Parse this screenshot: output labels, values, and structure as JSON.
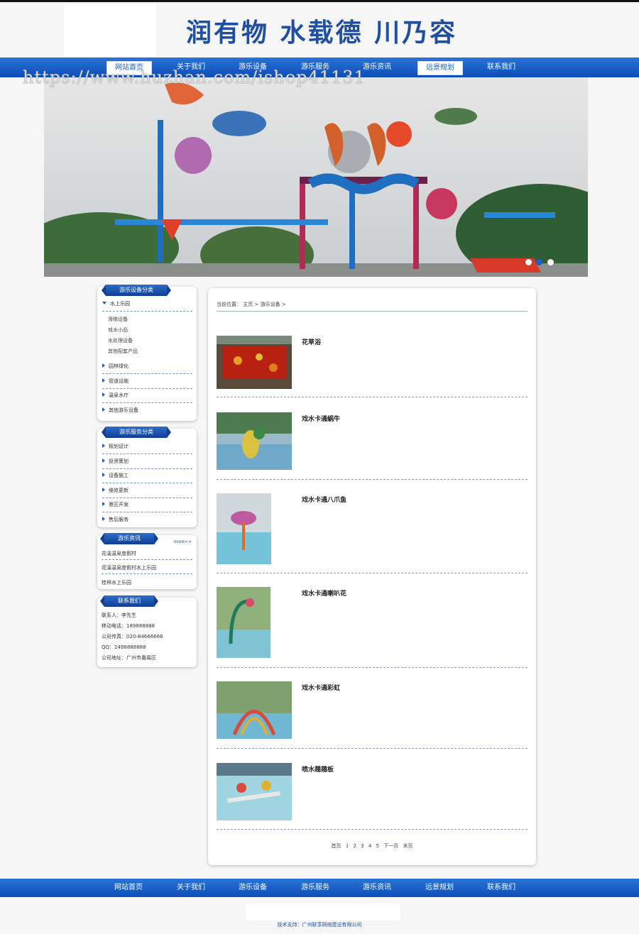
{
  "header": {
    "slogan": "润有物 水载德 川乃容"
  },
  "watermark": "https://www.huzhan.com/ishop41131",
  "nav": [
    {
      "label": "网站首页",
      "active": true
    },
    {
      "label": "关于我们",
      "active": false
    },
    {
      "label": "游乐设备",
      "active": false
    },
    {
      "label": "游乐服务",
      "active": false
    },
    {
      "label": "游乐资讯",
      "active": false
    },
    {
      "label": "远景规划",
      "active": true
    },
    {
      "label": "联系我们",
      "active": false
    }
  ],
  "footer_nav": [
    "网站首页",
    "关于我们",
    "游乐设备",
    "游乐服务",
    "游乐资讯",
    "远景规划",
    "联系我们"
  ],
  "sidebar": {
    "equipment": {
      "title": "游乐设备分类",
      "expanded": "水上乐园",
      "subitems": [
        "滑梯设备",
        "戏水小品",
        "水处理设备",
        "其他配套产品"
      ],
      "items": [
        "园林绿化",
        "管道设施",
        "温泉水疗",
        "其他游乐设备"
      ]
    },
    "services": {
      "title": "游乐服务分类",
      "items": [
        "规划设计",
        "投资策划",
        "设备施工",
        "维修更新",
        "景区开发",
        "售后服务"
      ]
    },
    "news": {
      "title": "游乐资讯",
      "more": "more>>",
      "items": [
        "花溪温泉度假村",
        "花溪温泉度假村水上乐园",
        "桂林水上乐园"
      ]
    },
    "contact": {
      "title": "联系我们",
      "lines": [
        "联系人：李先生",
        "移动电话：189888888",
        "公司传真：020-84666666",
        "QQ：2498888888",
        "公司地址：广州市番禺区"
      ]
    }
  },
  "breadcrumb": {
    "label": "当前位置：",
    "home": "主页",
    "sep": ">",
    "section": "游乐设备"
  },
  "products": [
    {
      "name": "花草浴"
    },
    {
      "name": "戏水卡通蜗牛"
    },
    {
      "name": "戏水卡通八爪鱼"
    },
    {
      "name": "戏水卡通喇叭花"
    },
    {
      "name": "戏水卡通彩虹"
    },
    {
      "name": "喷水翘翘板"
    }
  ],
  "pager": {
    "first": "首页",
    "pages": [
      "1",
      "2",
      "3",
      "4",
      "5"
    ],
    "next": "下一页",
    "last": "末页"
  },
  "footer": {
    "copyright": "技术支持：广州联享网络建设有限公司"
  },
  "colors": {
    "nav_blue": "#1a5fc8",
    "brand_text": "#1e4fa0"
  }
}
